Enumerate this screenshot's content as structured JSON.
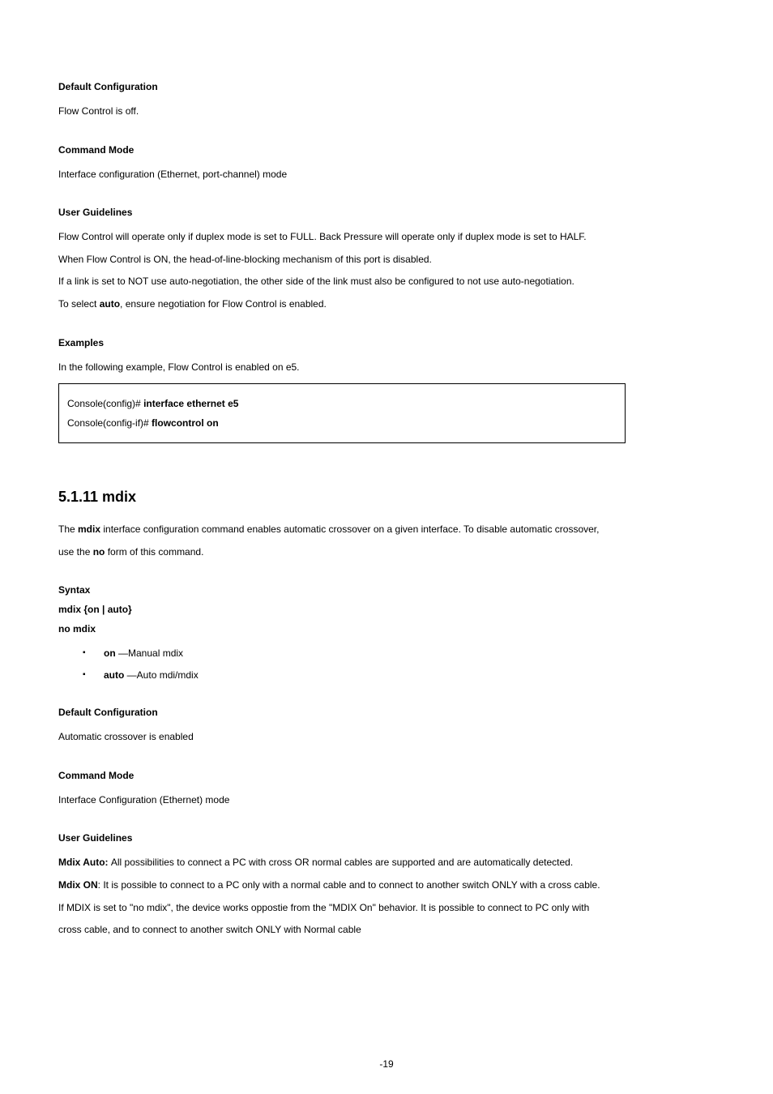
{
  "headings": {
    "defaultConfig1": "Default Configuration",
    "commandMode1": "Command Mode",
    "userGuidelines1": "User Guidelines",
    "examples": "Examples",
    "syntax": "Syntax",
    "defaultConfig2": "Default Configuration",
    "commandMode2": "Command Mode",
    "userGuidelines2": "User Guidelines"
  },
  "text": {
    "flowOff": "Flow Control is off.",
    "mode1": "Interface configuration (Ethernet, port-channel) mode",
    "ug1": "Flow Control will operate only if duplex mode is set to FULL. Back Pressure will operate only if duplex mode is set to HALF.",
    "ug2": "When Flow Control is ON, the head-of-line-blocking mechanism of this port is disabled.",
    "ug3": "If a link is set to NOT use auto-negotiation, the other side of the link must also be configured to not use auto-negotiation.",
    "ug4a": "To select ",
    "ug4bold": "auto",
    "ug4b": ", ensure negotiation for Flow Control is enabled.",
    "exIntro": "In the following example, Flow Control is enabled on e5.",
    "code1a": "Console(config)# ",
    "code1b": "interface ethernet e5",
    "code2a": "Console(config-if)# ",
    "code2b": "flowcontrol on",
    "cmdTitle": "5.1.11 mdix",
    "desc1a": "The ",
    "desc1bold": "mdix",
    "desc1b": " interface configuration command enables automatic crossover on a given interface. To disable automatic crossover,",
    "desc2a": "use the ",
    "desc2bold": "no",
    "desc2b": " form of this command.",
    "syntax1": "mdix {on | auto}",
    "syntax2": "no mdix",
    "bullet1bold": "on",
    "bullet1": " —Manual mdix",
    "bullet2bold": "auto",
    "bullet2": " —Auto mdi/mdix",
    "dc2": "Automatic crossover is enabled",
    "mode2": "Interface Configuration (Ethernet) mode",
    "ug2_1bold": "Mdix Auto: ",
    "ug2_1": "All possibilities to connect a PC with cross OR normal cables are supported and are automatically detected.",
    "ug2_2bold": "Mdix ON",
    "ug2_2": ": It is possible to connect to a PC only with a normal cable and to connect to another switch ONLY with a cross cable.",
    "ug2_3": "If MDIX is set to \"no mdix\", the device works oppostie from the \"MDIX On\" behavior. It is possible to connect to PC only with",
    "ug2_4": "cross cable, and to connect to another switch ONLY with Normal cable"
  },
  "pageNumber": "-19"
}
